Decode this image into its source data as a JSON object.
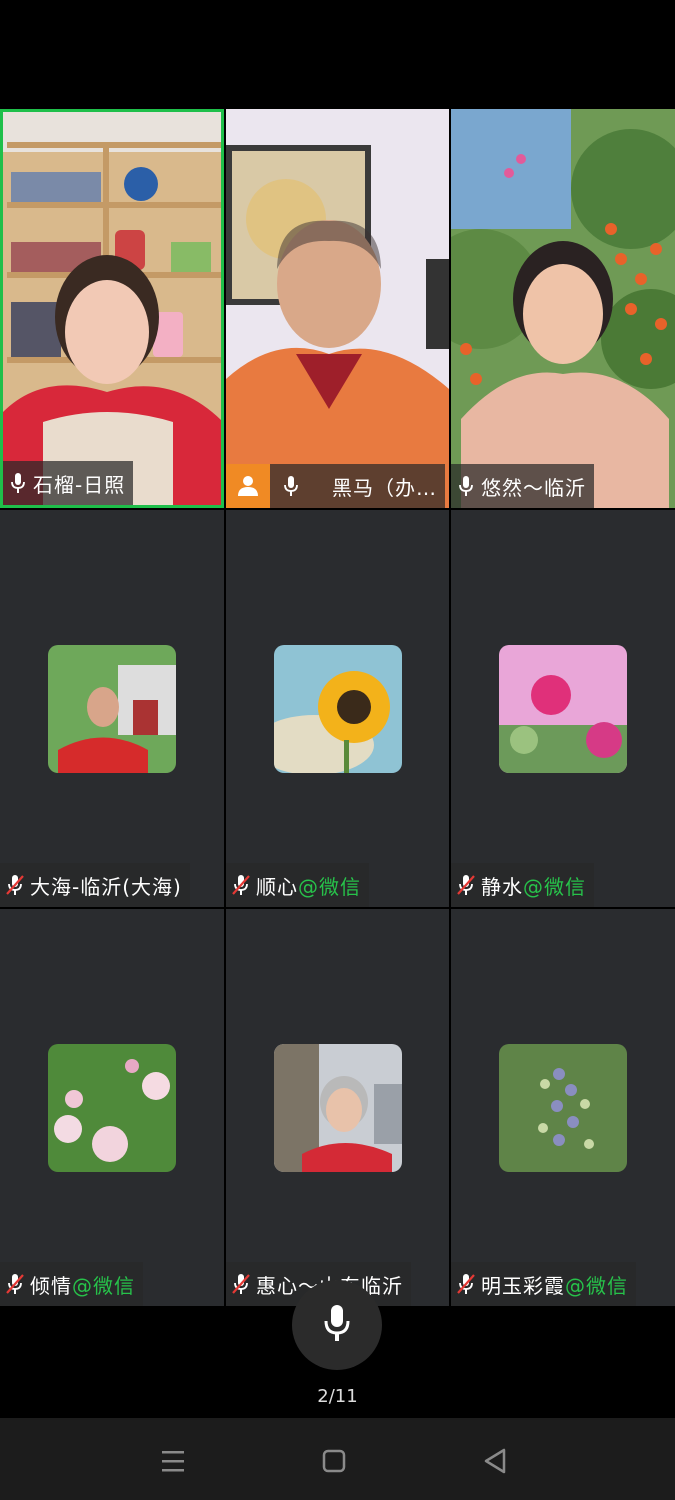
{
  "participants": [
    {
      "name": "石榴-日照",
      "suffix": "",
      "mic": "on",
      "video": true,
      "host": false,
      "active": true,
      "icon": "microphone-icon"
    },
    {
      "name": "黑马（办…",
      "suffix": "",
      "mic": "on",
      "video": true,
      "host": true,
      "active": false,
      "icon": "microphone-icon"
    },
    {
      "name": "悠然～临沂",
      "suffix": "",
      "mic": "on",
      "video": true,
      "host": false,
      "active": false,
      "icon": "microphone-icon"
    },
    {
      "name": "大海-临沂(大海)",
      "suffix": "",
      "mic": "muted",
      "video": false,
      "avatar": "man-red-shirt-garden",
      "icon": "microphone-muted-icon"
    },
    {
      "name": "顺心",
      "suffix": "@微信",
      "mic": "muted",
      "video": false,
      "avatar": "sunflower",
      "icon": "microphone-muted-icon"
    },
    {
      "name": "静水",
      "suffix": "@微信",
      "mic": "muted",
      "video": false,
      "avatar": "pink-flowers",
      "icon": "microphone-muted-icon"
    },
    {
      "name": "倾情",
      "suffix": "@微信",
      "mic": "muted",
      "video": false,
      "avatar": "peonies",
      "icon": "microphone-muted-icon"
    },
    {
      "name": "惠心～山东临沂",
      "suffix": "",
      "mic": "muted",
      "video": false,
      "avatar": "woman-stone-lion",
      "icon": "microphone-muted-icon"
    },
    {
      "name": "明玉彩霞",
      "suffix": "@微信",
      "mic": "muted",
      "video": false,
      "avatar": "blueberries",
      "icon": "microphone-muted-icon"
    }
  ],
  "controls": {
    "mic_button_icon": "microphone-icon"
  },
  "pager": {
    "text": "2/11"
  },
  "navbar": {
    "menu_icon": "menu-icon",
    "home_icon": "square-home-icon",
    "back_icon": "triangle-back-icon"
  },
  "colors": {
    "active_border": "#1fbf4a",
    "suffix": "#27c24a",
    "host_badge": "#f08a24",
    "tile_bg": "#2a2c2f"
  }
}
